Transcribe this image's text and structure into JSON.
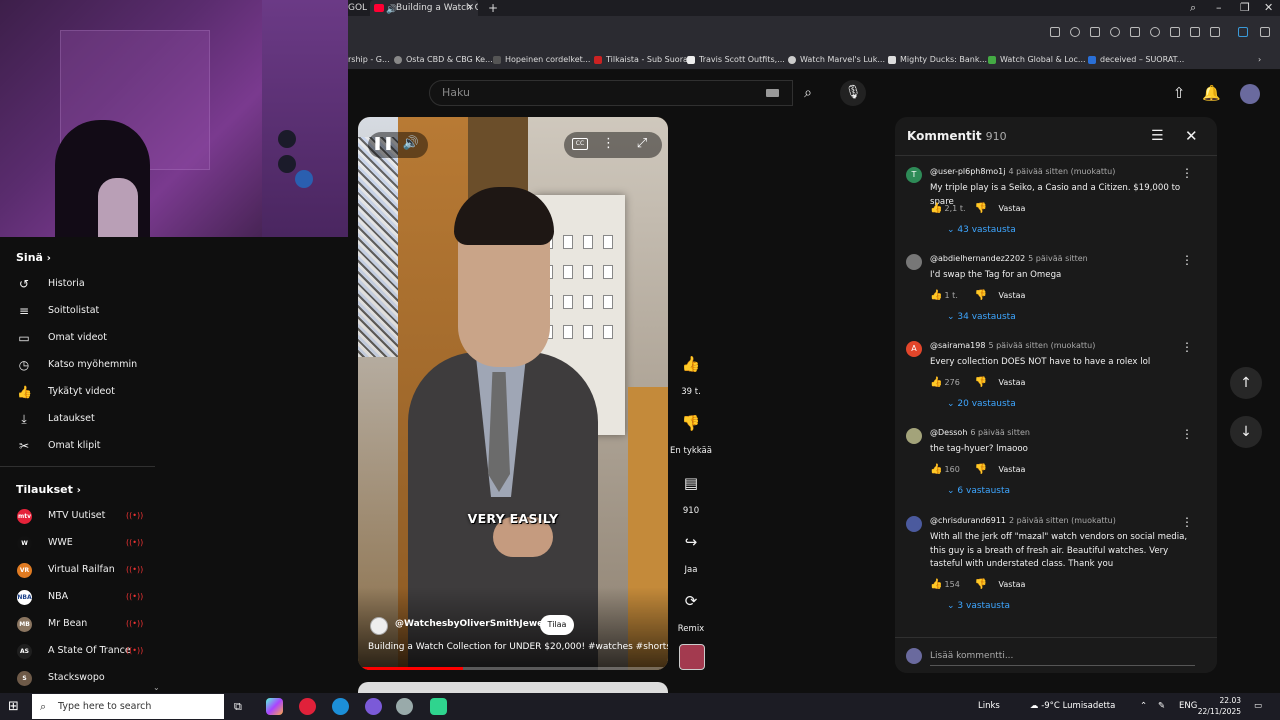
{
  "browser": {
    "active_tab_title": "Building a Watch Colle",
    "partial_tab": "GOL",
    "bookmarks": [
      "rship - G...",
      "Osta CBD & CBG Ke...",
      "Hopeinen cordelket...",
      "Tilkaista - Sub Suora",
      "Travis Scott Outfits,...",
      "Watch Marvel's Luk...",
      "Mighty Ducks: Bank...",
      "Watch Global & Loc...",
      "deceived – SUORAT..."
    ]
  },
  "search": {
    "placeholder": "Haku"
  },
  "sidebar": {
    "you_heading": "Sinä",
    "you_items": [
      {
        "icon": "history-icon",
        "label": "Historia"
      },
      {
        "icon": "playlist-icon",
        "label": "Soittolistat"
      },
      {
        "icon": "your-videos-icon",
        "label": "Omat videot"
      },
      {
        "icon": "watch-later-icon",
        "label": "Katso myöhemmin"
      },
      {
        "icon": "liked-icon",
        "label": "Tykätyt videot"
      },
      {
        "icon": "downloads-icon",
        "label": "Lataukset"
      },
      {
        "icon": "clips-icon",
        "label": "Omat klipit"
      }
    ],
    "subs_heading": "Tilaukset",
    "subscriptions": [
      {
        "name": "MTV Uutiset",
        "color": "#e5233a",
        "abbr": "mtv"
      },
      {
        "name": "WWE",
        "color": "#111111",
        "abbr": "W"
      },
      {
        "name": "Virtual Railfan",
        "color": "#e07b22",
        "abbr": "VR"
      },
      {
        "name": "NBA",
        "color": "#ffffff",
        "abbr": "NBA"
      },
      {
        "name": "Mr Bean",
        "color": "#8a7560",
        "abbr": "MB"
      },
      {
        "name": "A State Of Trance",
        "color": "#1f1f1f",
        "abbr": "AS"
      },
      {
        "name": "Stackswopo",
        "color": "#6e5a48",
        "abbr": "S"
      }
    ],
    "live_symbol": "((•))"
  },
  "video": {
    "caption": "VERY EASILY",
    "channel": "@WatchesbyOliverSmithJeweler",
    "subscribe_label": "Tilaa",
    "title": "Building a Watch Collection for UNDER $20,000! #watches #shorts",
    "progress": 0.34
  },
  "actions": {
    "like_count": "39 t.",
    "dislike_label": "En tykkää",
    "comment_count": "910",
    "share_label": "Jaa",
    "remix_label": "Remix"
  },
  "comments_panel": {
    "title": "Kommentit",
    "count": "910",
    "add_placeholder": "Lisää kommentti...",
    "reply_label": "Vastaa",
    "items": [
      {
        "author": "@user-pl6ph8mo1j",
        "time": "4 päivää sitten (muokattu)",
        "text": "My triple play is a Seiko, a Casio and a Citizen. $19,000 to spare",
        "likes": "2,1 t.",
        "replies": "43 vastausta",
        "avatar_color": "#2e8b57",
        "avatar_letter": "T"
      },
      {
        "author": "@abdielhernandez2202",
        "time": "5 päivää sitten",
        "text": "I'd swap the Tag for an Omega",
        "likes": "1 t.",
        "replies": "34 vastausta",
        "avatar_color": "#777777",
        "avatar_letter": ""
      },
      {
        "author": "@sairama198",
        "time": "5 päivää sitten (muokattu)",
        "text": "Every collection DOES NOT have to have a rolex lol",
        "likes": "276",
        "replies": "20 vastausta",
        "avatar_color": "#e2462b",
        "avatar_letter": "A"
      },
      {
        "author": "@Dessoh",
        "time": "6 päivää sitten",
        "text": "the tag-hyuer? lmaooo",
        "likes": "160",
        "replies": "6 vastausta",
        "avatar_color": "#a3a37a",
        "avatar_letter": ""
      },
      {
        "author": "@chrisdurand6911",
        "time": "2 päivää sitten (muokattu)",
        "text": "With all the jerk off \"mazal\" watch vendors on social media, this guy is a breath of fresh air. Beautiful watches. Very tasteful with understated class. Thank you",
        "likes": "154",
        "replies": "3 vastausta",
        "avatar_color": "#4b5a9e",
        "avatar_letter": ""
      }
    ]
  },
  "taskbar": {
    "search_placeholder": "Type here to search",
    "links_label": "Links",
    "weather": "-9°C  Lumisadetta",
    "language": "ENG",
    "time": "22.03",
    "date": "22/11/2025"
  }
}
